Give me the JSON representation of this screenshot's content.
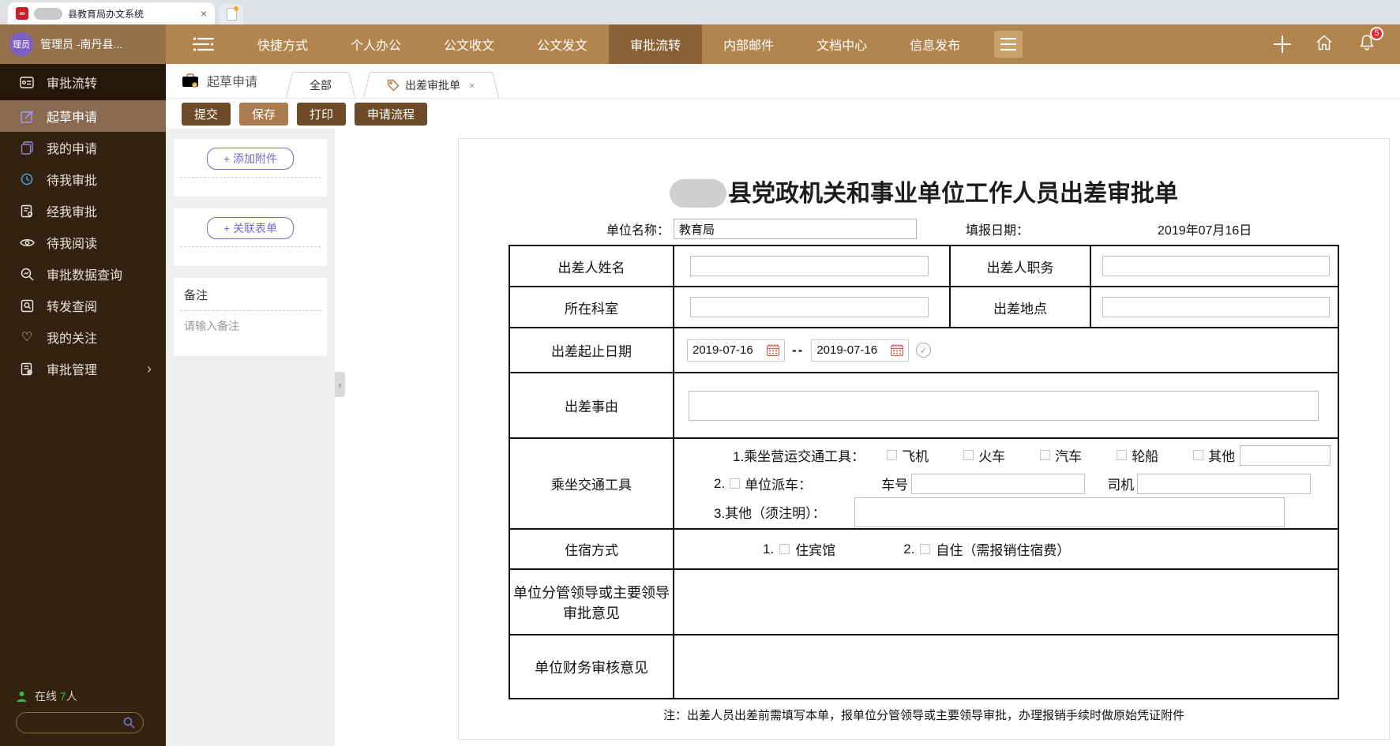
{
  "browser": {
    "favicon_glyph": "∞",
    "tab_title": "县教育局办文系统"
  },
  "icons": {
    "close": "×",
    "chevron_right": "›",
    "collapse": "‹",
    "check": "✓",
    "heart": "♡"
  },
  "header": {
    "avatar_text": "理员",
    "user_name": "管理员 -南丹县...",
    "nav": [
      {
        "label": "快捷方式"
      },
      {
        "label": "个人办公"
      },
      {
        "label": "公文收文"
      },
      {
        "label": "公文发文"
      },
      {
        "label": "审批流转"
      },
      {
        "label": "内部邮件"
      },
      {
        "label": "文档中心"
      },
      {
        "label": "信息发布"
      }
    ],
    "notification_count": "5"
  },
  "sidebar": {
    "items": [
      {
        "label": "审批流转"
      },
      {
        "label": "起草申请"
      },
      {
        "label": "我的申请"
      },
      {
        "label": "待我审批"
      },
      {
        "label": "经我审批"
      },
      {
        "label": "待我阅读"
      },
      {
        "label": "审批数据查询"
      },
      {
        "label": "转发查阅"
      },
      {
        "label": "我的关注"
      },
      {
        "label": "审批管理"
      }
    ],
    "online_text": "在线",
    "online_count": "7",
    "online_unit": "人"
  },
  "tabbar": {
    "section_label": "起草申请",
    "tab_all": "全部",
    "tab_form": "出差审批单"
  },
  "toolbar": {
    "submit": "提交",
    "save": "保存",
    "print": "打印",
    "flow": "申请流程"
  },
  "panel": {
    "add_attachment": "+ 添加附件",
    "add_form": "+ 关联表单",
    "note_label": "备注",
    "note_placeholder": "请输入备注"
  },
  "form": {
    "title": "县党政机关和事业单位工作人员出差审批单",
    "unit_label": "单位名称：",
    "unit_value": "教育局",
    "date_label": "填报日期：",
    "date_value": "2019年07月16日",
    "fields": {
      "name_label": "出差人姓名",
      "duty_label": "出差人职务",
      "dept_label": "所在科室",
      "dest_label": "出差地点",
      "range_label": "出差起止日期",
      "date_start": "2019-07-16",
      "date_sep": "--",
      "date_end": "2019-07-16",
      "reason_label": "出差事由",
      "transport_label": "乘坐交通工具",
      "transport_line1": "1.乘坐营运交通工具：",
      "transport_options": [
        "飞机",
        "火车",
        "汽车",
        "轮船",
        "其他"
      ],
      "transport_line2_num": "2.",
      "transport_line2_label": "单位派车：",
      "car_no_label": "车号",
      "driver_label": "司机",
      "transport_line3": "3.其他（须注明）：",
      "stay_label": "住宿方式",
      "stay_opt1_num": "1.",
      "stay_opt1": "住宾馆",
      "stay_opt2_num": "2.",
      "stay_opt2": "自住（需报销住宿费）",
      "leader_label": "单位分管领导或主要领导审批意见",
      "finance_label": "单位财务审核意见"
    },
    "footer_note": "注：出差人员出差前需填写本单，报单位分管领导或主要领导审批，办理报销手续时做原始凭证附件"
  },
  "colors": {
    "header_brown": "#b2854f",
    "nav_active_brown": "#8a6036",
    "sidebar_dark": "#33220f",
    "sidebar_active": "#8a6b52",
    "button_brown": "#6e4b28",
    "save_brown": "#a87c50",
    "accent_purple": "#7668c9",
    "badge_red": "#e8262d",
    "online_green": "#3cb54a",
    "calendar_red": "#e74c3c"
  }
}
